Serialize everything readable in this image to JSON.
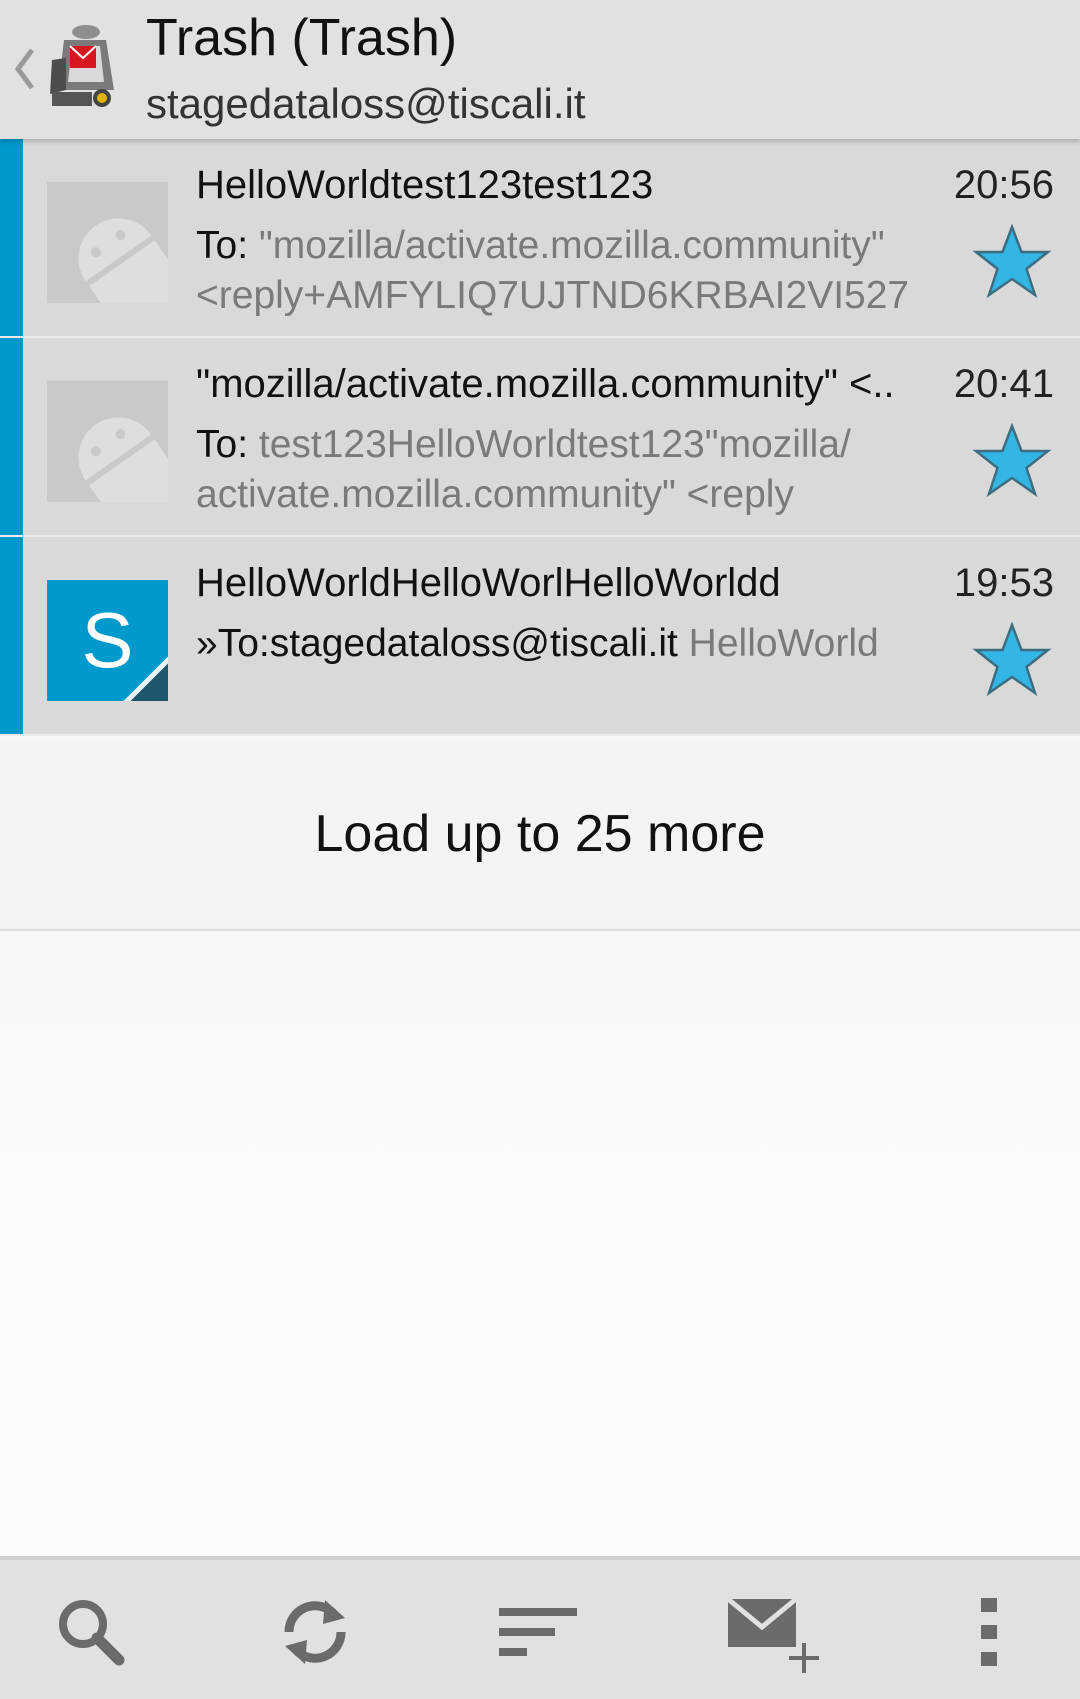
{
  "header": {
    "title": "Trash (Trash)",
    "account": "stagedataloss@tiscali.it",
    "back_icon": "chevron-left-icon",
    "logo_icon": "k9-mail-logo-icon"
  },
  "messages": [
    {
      "subject": "HelloWorldtest123test123",
      "time": "20:56",
      "preview_label": "To: ",
      "preview_text": "\"mozilla/activate.mozilla.community\" <reply+AMFYLIQ7UJTND6KRBAI2VI527",
      "avatar": "android-placeholder",
      "starred": true
    },
    {
      "subject": "\"mozilla/activate.mozilla.community\" <..",
      "time": "20:41",
      "preview_label": "To: ",
      "preview_text": "test123HelloWorldtest123\"mozilla/ activate.mozilla.community\" <reply",
      "avatar": "android-placeholder",
      "starred": true
    },
    {
      "subject": "HelloWorldHelloWorlHelloWorldd",
      "time": "19:53",
      "preview_label": "»To:stagedataloss@tiscali.it ",
      "preview_text": "HelloWorld",
      "avatar": "letter",
      "avatar_letter": "S",
      "starred": true
    }
  ],
  "load_more": "Load up to 25 more",
  "bottom_bar": {
    "icons": [
      "search-icon",
      "refresh-icon",
      "sort-icon",
      "compose-icon",
      "overflow-menu-icon"
    ]
  },
  "colors": {
    "accent": "#0099cc",
    "star": "#33b5e5",
    "header_bg": "#e1e1e1",
    "row_bg": "#d9d9d9"
  }
}
